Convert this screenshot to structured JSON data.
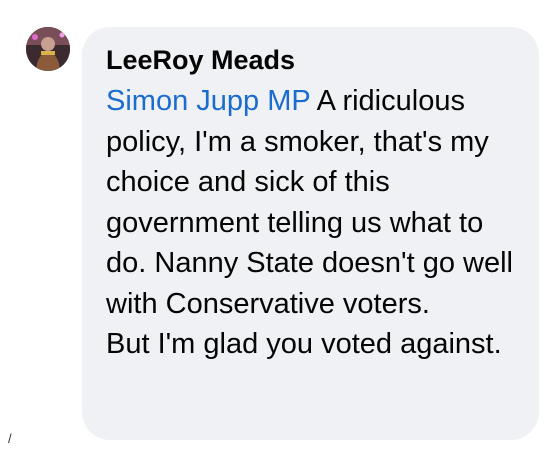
{
  "comment": {
    "author": "LeeRoy Meads",
    "mention": "Simon Jupp MP",
    "paragraph_1": "A ridiculous policy, I'm a smoker, that's my choice and sick of this government telling us what to do. Nanny State doesn't go well with Conservative voters.",
    "paragraph_2": "But I'm glad you voted against."
  },
  "edge_mark": "/",
  "colors": {
    "bubble_background": "#eff1f4",
    "mention_link": "#1b6ccf",
    "text": "#050505"
  },
  "icons": {
    "avatar": "profile-photo"
  }
}
